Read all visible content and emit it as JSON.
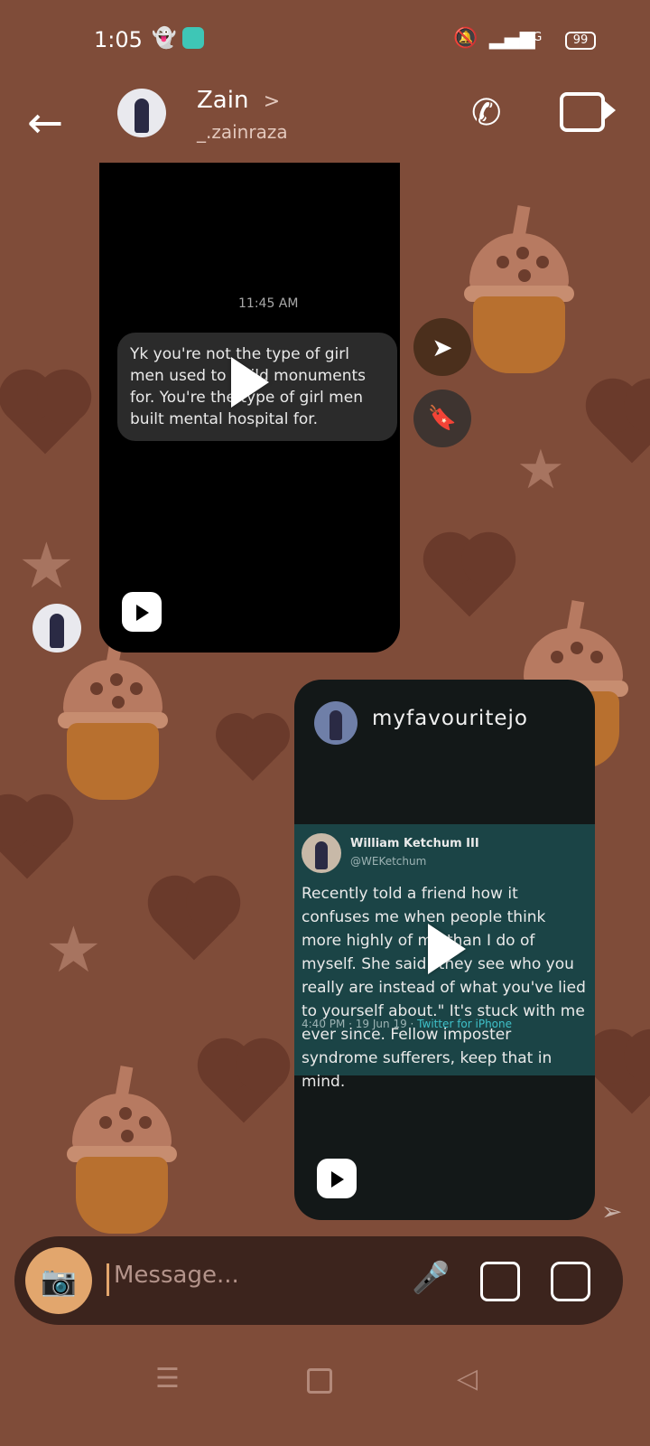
{
  "status_bar": {
    "time": "1:05",
    "network": "4G",
    "battery": "99"
  },
  "header": {
    "name": "Zain",
    "chevron": ">",
    "username": "_.zainraza"
  },
  "reel1": {
    "time": "11:45 AM",
    "text": "Yk you're not the type of girl men used to build monuments for. You're the type of girl men built mental hospital for."
  },
  "reel2": {
    "username": "myfavouritejo",
    "tweet": {
      "name": "William Ketchum III",
      "handle": "@WEKetchum",
      "text": "Recently told a friend how it confuses me when people think more highly of me than I do of myself. She said \"they see who you really are instead of what you've lied to yourself about.\" It's stuck with me ever since. Fellow imposter syndrome sufferers, keep that in mind.",
      "meta_time": "4:40 PM · 19 Jun 19 · ",
      "meta_app": "Twitter for iPhone"
    }
  },
  "composer": {
    "placeholder": "Message..."
  },
  "icons": {
    "back": "arrow-left",
    "call": "phone",
    "video": "video-camera",
    "share": "paper-plane",
    "save": "bookmark",
    "camera": "camera",
    "mic": "microphone",
    "gallery": "image",
    "sticker": "sticker"
  },
  "colors": {
    "background": "#7f4c39",
    "composer": "#3c241d",
    "camera_accent": "#e2a66d"
  }
}
